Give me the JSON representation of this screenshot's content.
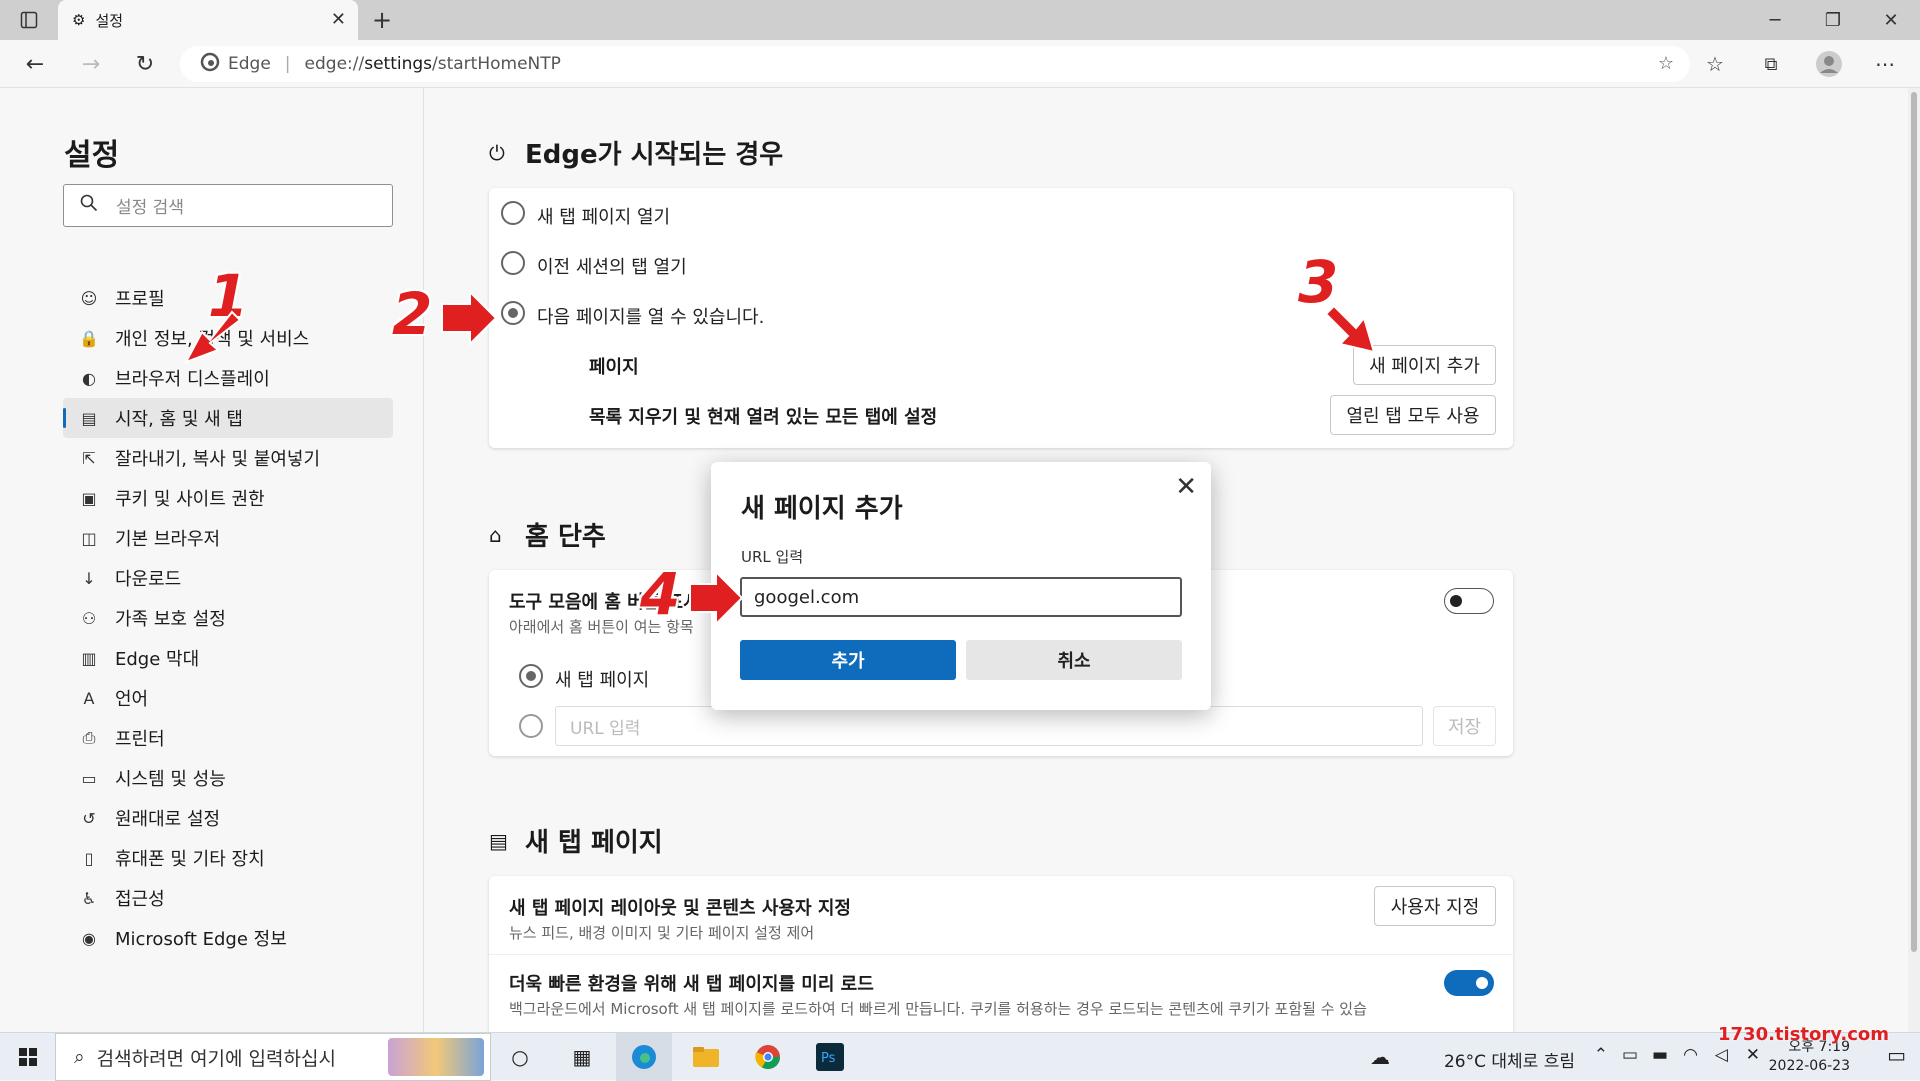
{
  "window": {
    "tab_title": "설정",
    "address_brand": "Edge",
    "address_separator": "|",
    "address_prefix": "edge://",
    "address_bold": "settings",
    "address_rest": "/startHomeNTP"
  },
  "sidebar": {
    "title": "설정",
    "search_placeholder": "설정 검색",
    "items": [
      {
        "label": "프로필",
        "icon": "profile-icon"
      },
      {
        "label": "개인 정보, 검색 및 서비스",
        "icon": "lock-icon"
      },
      {
        "label": "브라우저 디스플레이",
        "icon": "palette-icon"
      },
      {
        "label": "시작, 홈 및 새 탭",
        "icon": "start-page-icon",
        "active": true
      },
      {
        "label": "잘라내기, 복사 및 붙여넣기",
        "icon": "share-icon"
      },
      {
        "label": "쿠키 및 사이트 권한",
        "icon": "cookie-icon"
      },
      {
        "label": "기본 브라우저",
        "icon": "default-browser-icon"
      },
      {
        "label": "다운로드",
        "icon": "download-icon"
      },
      {
        "label": "가족 보호 설정",
        "icon": "family-icon"
      },
      {
        "label": "Edge 막대",
        "icon": "edge-bar-icon"
      },
      {
        "label": "언어",
        "icon": "language-icon"
      },
      {
        "label": "프린터",
        "icon": "printer-icon"
      },
      {
        "label": "시스템 및 성능",
        "icon": "system-icon"
      },
      {
        "label": "원래대로 설정",
        "icon": "reset-icon"
      },
      {
        "label": "휴대폰 및 기타 장치",
        "icon": "phone-icon"
      },
      {
        "label": "접근성",
        "icon": "accessibility-icon"
      },
      {
        "label": "Microsoft Edge 정보",
        "icon": "edge-logo-icon"
      }
    ]
  },
  "startup": {
    "title": "Edge가 시작되는 경우",
    "options": [
      "새 탭 페이지 열기",
      "이전 세션의 탭 열기",
      "다음 페이지를 열 수 있습니다."
    ],
    "pages_label": "페이지",
    "add_page_button": "새 페이지 추가",
    "clear_label": "목록 지우기 및 현재 열려 있는 모든 탭에 설정",
    "use_all_tabs_button": "열린 탭 모두 사용"
  },
  "home": {
    "title": "홈 단추",
    "toolbar_label": "도구 모음에 홈 버튼 표시",
    "toolbar_desc": "아래에서 홈 버튼이 여는 항목",
    "option_new_tab": "새 탭 페이지",
    "url_placeholder": "URL 입력",
    "save_button": "저장"
  },
  "newtab": {
    "title": "새 탭 페이지",
    "customize_label": "새 탭 페이지 레이아웃 및 콘텐츠 사용자 지정",
    "customize_desc": "뉴스 피드, 배경 이미지 및 기타 페이지 설정 제어",
    "customize_button": "사용자 지정",
    "preload_label": "더욱 빠른 환경을 위해 새 탭 페이지를 미리 로드",
    "preload_desc": "백그라운드에서 Microsoft 새 탭 페이지를 로드하여 더 빠르게 만듭니다. 쿠키를 허용하는 경우 로드되는 콘텐츠에 쿠키가 포함될 수 있습"
  },
  "dialog": {
    "title": "새 페이지 추가",
    "field_label": "URL 입력",
    "input_value": "googel.com",
    "add_button": "추가",
    "cancel_button": "취소"
  },
  "annotations": [
    "1",
    "2",
    "3",
    "4"
  ],
  "taskbar": {
    "search_placeholder": "검색하려면 여기에 입력하십시",
    "weather": "26°C 대체로 흐림",
    "time": "오후 7:19",
    "date": "2022-06-23",
    "watermark": "1730.tistory.com"
  },
  "colors": {
    "accent": "#0f6cbd",
    "annotation": "#e02020"
  }
}
